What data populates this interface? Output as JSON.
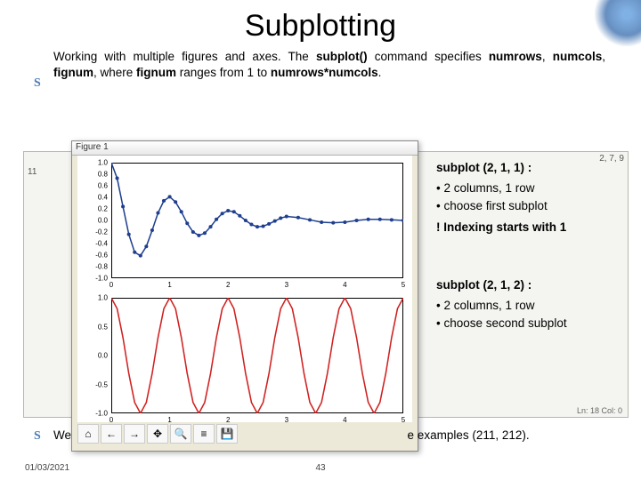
{
  "title": "Subplotting",
  "bullet_glyph": "S",
  "para1_parts": [
    {
      "t": "Working with multiple figures and axes. The "
    },
    {
      "t": "subplot()",
      "b": true
    },
    {
      "t": " command specifies "
    },
    {
      "t": "numrows",
      "b": true
    },
    {
      "t": ", "
    },
    {
      "t": "numcols",
      "b": true
    },
    {
      "t": ", "
    },
    {
      "t": "fignum",
      "b": true
    },
    {
      "t": ", where "
    },
    {
      "t": "fignum",
      "b": true
    },
    {
      "t": " ranges from 1 to "
    },
    {
      "t": "numrows*numcols",
      "b": true
    },
    {
      "t": "."
    }
  ],
  "para2_prefix": "We",
  "para2_suffix": "e examples (211, 212).",
  "figure": {
    "title": "Figure 1",
    "toolbar_icons": [
      "home-icon",
      "back-icon",
      "forward-icon",
      "pan-icon",
      "zoom-icon",
      "config-icon",
      "save-icon"
    ],
    "toolbar_glyphs": [
      "⌂",
      "←",
      "→",
      "✥",
      "🔍",
      "≡",
      "💾"
    ]
  },
  "bg_window": {
    "line1": "2, 7, 9",
    "line2": "11",
    "status": "Ln: 18 Col: 0"
  },
  "ann": {
    "s1_heading": "subplot (2, 1, 1) :",
    "s1_rowcol": "• 2 columns, 1 row",
    "s1_choose": "• choose first subplot",
    "s1_warn": "! Indexing starts with 1",
    "s2_heading": "subplot (2, 1, 2) :",
    "s2_rowcol": "• 2 columns, 1 row",
    "s2_choose": "• choose second subplot"
  },
  "footer": {
    "date": "01/03/2021",
    "page": "43"
  },
  "chart_data": [
    {
      "type": "line",
      "title": "",
      "xlabel": "",
      "ylabel": "",
      "xlim": [
        0,
        5
      ],
      "ylim": [
        -1.0,
        1.0
      ],
      "xticks": [
        0,
        1,
        2,
        3,
        4,
        5
      ],
      "yticks": [
        -1.0,
        -0.8,
        -0.6,
        -0.4,
        -0.2,
        0.0,
        0.2,
        0.4,
        0.6,
        0.8,
        1.0
      ],
      "style": "damped-cosine-dots-line",
      "color": "#1f3f8f",
      "x": [
        0.0,
        0.1,
        0.2,
        0.3,
        0.4,
        0.5,
        0.6,
        0.7,
        0.8,
        0.9,
        1.0,
        1.1,
        1.2,
        1.3,
        1.4,
        1.5,
        1.6,
        1.7,
        1.8,
        1.9,
        2.0,
        2.1,
        2.2,
        2.3,
        2.4,
        2.5,
        2.6,
        2.7,
        2.8,
        2.9,
        3.0,
        3.2,
        3.4,
        3.6,
        3.8,
        4.0,
        4.2,
        4.4,
        4.6,
        4.8,
        5.0
      ],
      "y": [
        1.0,
        0.73,
        0.24,
        -0.24,
        -0.55,
        -0.61,
        -0.45,
        -0.17,
        0.13,
        0.34,
        0.41,
        0.32,
        0.15,
        -0.05,
        -0.2,
        -0.26,
        -0.22,
        -0.11,
        0.02,
        0.12,
        0.17,
        0.15,
        0.08,
        0.0,
        -0.07,
        -0.11,
        -0.1,
        -0.06,
        -0.01,
        0.04,
        0.07,
        0.05,
        0.01,
        -0.03,
        -0.04,
        -0.03,
        0.0,
        0.02,
        0.02,
        0.01,
        0.0
      ]
    },
    {
      "type": "line",
      "title": "",
      "xlabel": "",
      "ylabel": "",
      "xlim": [
        0,
        5
      ],
      "ylim": [
        -1.0,
        1.0
      ],
      "xticks": [
        0,
        1,
        2,
        3,
        4,
        5
      ],
      "yticks": [
        -1.0,
        -0.5,
        0.0,
        0.5,
        1.0
      ],
      "style": "cosine-line",
      "color": "#d02020",
      "x": [
        0.0,
        0.1,
        0.2,
        0.3,
        0.4,
        0.5,
        0.6,
        0.7,
        0.8,
        0.9,
        1.0,
        1.1,
        1.2,
        1.3,
        1.4,
        1.5,
        1.6,
        1.7,
        1.8,
        1.9,
        2.0,
        2.1,
        2.2,
        2.3,
        2.4,
        2.5,
        2.6,
        2.7,
        2.8,
        2.9,
        3.0,
        3.1,
        3.2,
        3.3,
        3.4,
        3.5,
        3.6,
        3.7,
        3.8,
        3.9,
        4.0,
        4.1,
        4.2,
        4.3,
        4.4,
        4.5,
        4.6,
        4.7,
        4.8,
        4.9,
        5.0
      ],
      "y": [
        1.0,
        0.81,
        0.31,
        -0.31,
        -0.81,
        -1.0,
        -0.81,
        -0.31,
        0.31,
        0.81,
        1.0,
        0.81,
        0.31,
        -0.31,
        -0.81,
        -1.0,
        -0.81,
        -0.31,
        0.31,
        0.81,
        1.0,
        0.81,
        0.31,
        -0.31,
        -0.81,
        -1.0,
        -0.81,
        -0.31,
        0.31,
        0.81,
        1.0,
        0.81,
        0.31,
        -0.31,
        -0.81,
        -1.0,
        -0.81,
        -0.31,
        0.31,
        0.81,
        1.0,
        0.81,
        0.31,
        -0.31,
        -0.81,
        -1.0,
        -0.81,
        -0.31,
        0.31,
        0.81,
        1.0
      ]
    }
  ]
}
